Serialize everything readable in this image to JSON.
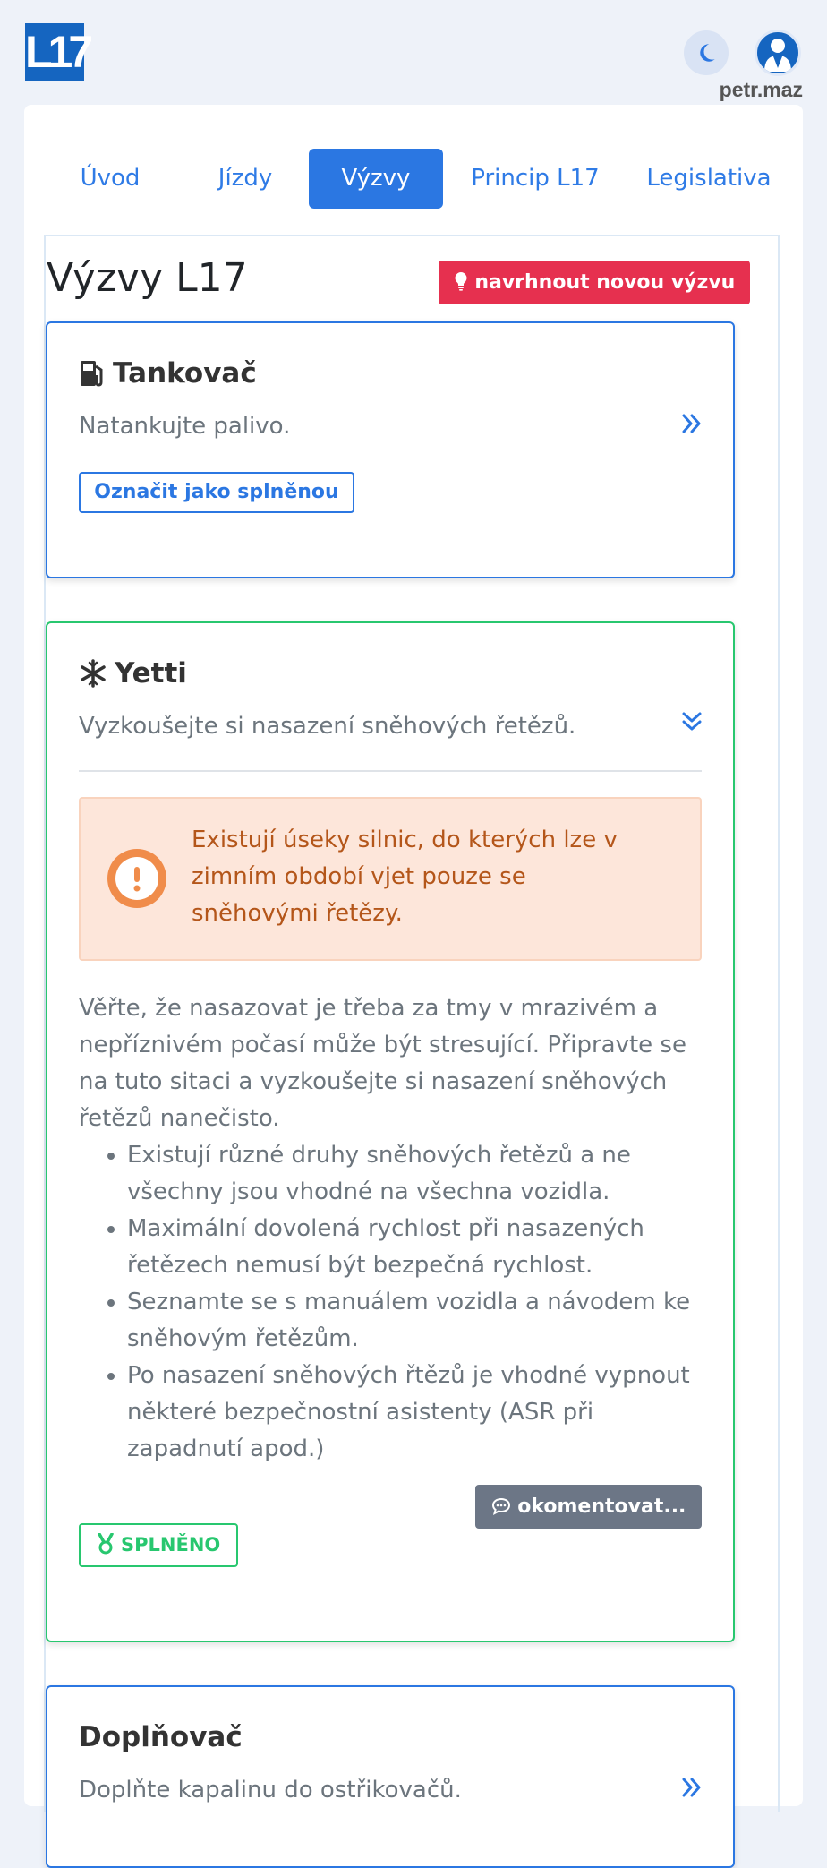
{
  "header": {
    "logo_text": "L17",
    "username": "petr.maz"
  },
  "tabs": [
    {
      "label": "Úvod",
      "active": false
    },
    {
      "label": "Jízdy",
      "active": false
    },
    {
      "label": "Výzvy",
      "active": true
    },
    {
      "label": "Princip L17",
      "active": false
    },
    {
      "label": "Legislativa",
      "active": false
    }
  ],
  "page": {
    "title": "Výzvy L17",
    "suggest_button": "navrhnout novou výzvu"
  },
  "challenges": [
    {
      "title": "Tankovač",
      "icon": "gas-pump-icon",
      "description": "Natankujte palivo.",
      "mark_button": "Označit jako splněnou"
    },
    {
      "title": "Yetti",
      "icon": "snowflake-icon",
      "description": "Vyzkoušejte si nasazení sněhových řetězů.",
      "alert": "Existují úseky silnic, do kterých lze v zimním období vjet pouze se sněhovými řetězy.",
      "body": "Věřte, že nasazovat je třeba za tmy v mrazivém a nepříznivém počasí může být stresující. Připravte se na tuto sitaci a vyzkoušejte si nasazení sněhových řetězů nanečisto.",
      "bullets": [
        "Existují různé druhy sněhových řetězů a ne všechny jsou vhodné na všechna vozidla.",
        "Maximální dovolená rychlost při nasazených řetězech nemusí být bezpečná rychlost.",
        "Seznamte se s manuálem vozidla a návodem ke sněhovým řetězům.",
        "Po nasazení sněhových řtězů je vhodné vypnout některé bezpečnostní asistenty (ASR při zapadnutí apod.)"
      ],
      "comment_button": "okomentovat...",
      "status": "SPLNĚNO"
    },
    {
      "title": "Doplňovač",
      "description": "Doplňte kapalinu do ostřikovačů."
    }
  ],
  "colors": {
    "primary": "#2b77e2",
    "danger": "#e6304f",
    "success": "#28c76f",
    "warning_bg": "#fde6da",
    "warning_text": "#b4561a"
  }
}
